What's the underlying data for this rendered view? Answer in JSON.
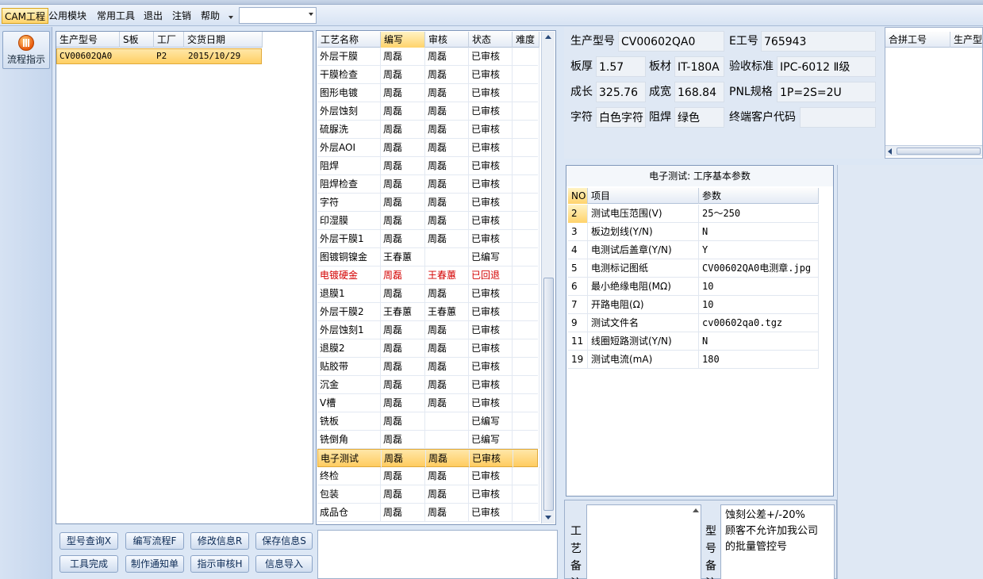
{
  "menu": {
    "items": [
      "CAM工程",
      "公用模块",
      "常用工具",
      "退出",
      "注销",
      "帮助"
    ],
    "combo_value": ""
  },
  "nav": {
    "flow_label": "流程指示"
  },
  "orders": {
    "headers": [
      "生产型号",
      "S板",
      "工厂",
      "交货日期"
    ],
    "rows": [
      {
        "model": "CV00602QA0",
        "s": "",
        "factory": "P2",
        "date": "2015/10/29"
      }
    ]
  },
  "process": {
    "headers": [
      "工艺名称",
      "编写",
      "审核",
      "状态",
      "难度"
    ],
    "rows": [
      {
        "name": "外层干膜",
        "writer": "周磊",
        "reviewer": "周磊",
        "status": "已审核",
        "diff": ""
      },
      {
        "name": "干膜检查",
        "writer": "周磊",
        "reviewer": "周磊",
        "status": "已审核",
        "diff": ""
      },
      {
        "name": "图形电镀",
        "writer": "周磊",
        "reviewer": "周磊",
        "status": "已审核",
        "diff": ""
      },
      {
        "name": "外层蚀刻",
        "writer": "周磊",
        "reviewer": "周磊",
        "status": "已审核",
        "diff": ""
      },
      {
        "name": "硫脲洗",
        "writer": "周磊",
        "reviewer": "周磊",
        "status": "已审核",
        "diff": ""
      },
      {
        "name": "外层AOI",
        "writer": "周磊",
        "reviewer": "周磊",
        "status": "已审核",
        "diff": ""
      },
      {
        "name": "阻焊",
        "writer": "周磊",
        "reviewer": "周磊",
        "status": "已审核",
        "diff": ""
      },
      {
        "name": "阻焊检查",
        "writer": "周磊",
        "reviewer": "周磊",
        "status": "已审核",
        "diff": ""
      },
      {
        "name": "字符",
        "writer": "周磊",
        "reviewer": "周磊",
        "status": "已审核",
        "diff": ""
      },
      {
        "name": "印湿膜",
        "writer": "周磊",
        "reviewer": "周磊",
        "status": "已审核",
        "diff": ""
      },
      {
        "name": "外层干膜1",
        "writer": "周磊",
        "reviewer": "周磊",
        "status": "已审核",
        "diff": ""
      },
      {
        "name": "图镀铜镍金",
        "writer": "王春蕙",
        "reviewer": "",
        "status": "已编写",
        "diff": ""
      },
      {
        "name": "电镀硬金",
        "writer": "周磊",
        "reviewer": "王春蕙",
        "status": "已回退",
        "diff": ""
      },
      {
        "name": "退膜1",
        "writer": "周磊",
        "reviewer": "周磊",
        "status": "已审核",
        "diff": ""
      },
      {
        "name": "外层干膜2",
        "writer": "王春蕙",
        "reviewer": "王春蕙",
        "status": "已审核",
        "diff": ""
      },
      {
        "name": "外层蚀刻1",
        "writer": "周磊",
        "reviewer": "周磊",
        "status": "已审核",
        "diff": ""
      },
      {
        "name": "退膜2",
        "writer": "周磊",
        "reviewer": "周磊",
        "status": "已审核",
        "diff": ""
      },
      {
        "name": "贴胶带",
        "writer": "周磊",
        "reviewer": "周磊",
        "status": "已审核",
        "diff": ""
      },
      {
        "name": "沉金",
        "writer": "周磊",
        "reviewer": "周磊",
        "status": "已审核",
        "diff": ""
      },
      {
        "name": "V槽",
        "writer": "周磊",
        "reviewer": "周磊",
        "status": "已审核",
        "diff": ""
      },
      {
        "name": "铣板",
        "writer": "周磊",
        "reviewer": "",
        "status": "已编写",
        "diff": ""
      },
      {
        "name": "铣倒角",
        "writer": "周磊",
        "reviewer": "",
        "status": "已编写",
        "diff": ""
      },
      {
        "name": "电子测试",
        "writer": "周磊",
        "reviewer": "周磊",
        "status": "已审核",
        "diff": ""
      },
      {
        "name": "终检",
        "writer": "周磊",
        "reviewer": "周磊",
        "status": "已审核",
        "diff": ""
      },
      {
        "name": "包装",
        "writer": "周磊",
        "reviewer": "周磊",
        "status": "已审核",
        "diff": ""
      },
      {
        "name": "成品仓",
        "writer": "周磊",
        "reviewer": "周磊",
        "status": "已审核",
        "diff": ""
      }
    ],
    "selected_index": 22,
    "red_index": 12
  },
  "info": {
    "model_label": "生产型号",
    "model_value": "CV00602QA0",
    "eno_label": "E工号",
    "eno_value": "765943",
    "thick_label": "板厚",
    "thick_value": "1.57",
    "mat_label": "板材",
    "mat_value": "IT-180A",
    "std_label": "验收标准",
    "std_value": "IPC-6012 Ⅱ级",
    "len_label": "成长",
    "len_value": "325.76",
    "wid_label": "成宽",
    "wid_value": "168.84",
    "pnl_label": "PNL规格",
    "pnl_value": "1P=2S=2U",
    "char_label": "字符",
    "char_value": "白色字符",
    "mask_label": "阻焊",
    "mask_value": "绿色",
    "cust_label": "终端客户代码",
    "cust_value": ""
  },
  "merge": {
    "headers": [
      "合拼工号",
      "生产型"
    ]
  },
  "etest": {
    "title": "电子测试: 工序基本参数",
    "headers": [
      "NO",
      "项目",
      "参数"
    ],
    "rows": [
      {
        "no": "2",
        "item": "测试电压范围(V)",
        "param": "25～250"
      },
      {
        "no": "3",
        "item": "板边划线(Y/N)",
        "param": "N"
      },
      {
        "no": "4",
        "item": "电测试后盖章(Y/N)",
        "param": "Y"
      },
      {
        "no": "5",
        "item": "电测标记图纸",
        "param": "CV00602QA0电测章.jpg"
      },
      {
        "no": "6",
        "item": "最小绝缘电阻(MΩ)",
        "param": "10"
      },
      {
        "no": "7",
        "item": "开路电阻(Ω)",
        "param": "10"
      },
      {
        "no": "9",
        "item": "测试文件名",
        "param": "cv00602qa0.tgz"
      },
      {
        "no": "11",
        "item": "线圈短路测试(Y/N)",
        "param": "N"
      },
      {
        "no": "19",
        "item": "测试电流(mA)",
        "param": "180"
      }
    ]
  },
  "buttons": {
    "row1": [
      "型号查询X",
      "编写流程F",
      "修改信息R",
      "保存信息S"
    ],
    "row2": [
      "工具完成",
      "制作通知单",
      "指示审核H",
      "信息导入"
    ]
  },
  "notes": {
    "process_label": "工艺备注",
    "model_label": "型号备注",
    "model_text": "蚀刻公差+/-20%\n顾客不允许加我公司的批量管控号"
  }
}
